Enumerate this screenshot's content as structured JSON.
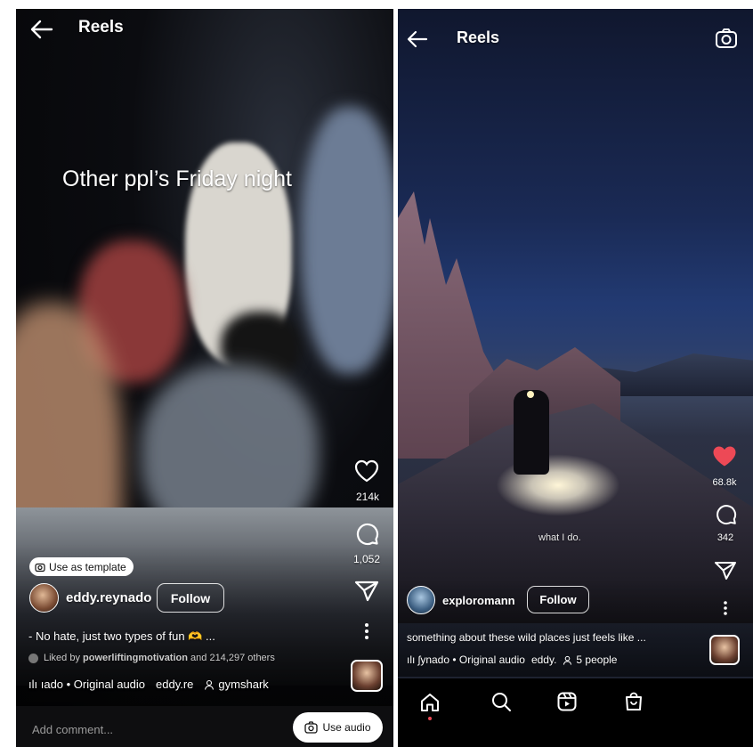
{
  "left": {
    "header": {
      "title": "Reels"
    },
    "overlay_text": "Other ppl’s Friday night",
    "actions": {
      "likes": "214k",
      "comments": "1,052"
    },
    "template_chip": "Use as template",
    "username": "eddy.reynado",
    "follow_label": "Follow",
    "caption": "- No hate, just two types of fun 🫶 ...",
    "liked_by": {
      "prefix": "Liked by ",
      "user": "powerliftingmotivation",
      "suffix": " and 214,297 others"
    },
    "audio": {
      "text": "ılı ıado • Original audio",
      "tag": "eddy.re",
      "collab": "gymshark"
    },
    "comment": {
      "placeholder": "Add comment...",
      "use_audio": "Use audio"
    }
  },
  "right": {
    "header": {
      "title": "Reels"
    },
    "video_caption": "what I do.",
    "actions": {
      "likes": "68.8k",
      "comments": "342"
    },
    "username": "exploromann",
    "follow_label": "Follow",
    "caption": "something about these wild places just feels like ...",
    "audio": {
      "text": "ılı ʃynado • Original audio",
      "tag": "eddy.",
      "people": "5 people"
    },
    "nav": [
      "home-icon",
      "search-icon",
      "reels-icon",
      "shop-icon"
    ]
  },
  "colors": {
    "like_red": "#ed4956",
    "text": "#ffffff"
  }
}
